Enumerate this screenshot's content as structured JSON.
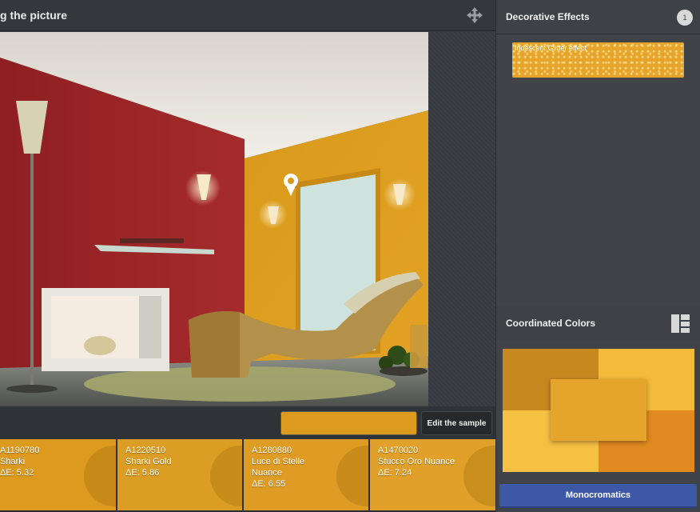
{
  "header": {
    "title": "g the picture",
    "move_icon": "move-arrows-icon"
  },
  "sample": {
    "color": "#dc9a1f",
    "edit_label": "Edit the sample"
  },
  "results": [
    {
      "code": "A1190780",
      "name_lines": [
        "Sharki"
      ],
      "delta": "ΔE: 5.32",
      "color": "#dc9a1f"
    },
    {
      "code": "A1220510",
      "name_lines": [
        "Sharki Gold"
      ],
      "delta": "ΔE: 5.86",
      "color": "#dc9d24"
    },
    {
      "code": "A1280880",
      "name_lines": [
        "Luce di Stelle",
        "Nuance"
      ],
      "delta": "ΔE: 6.55",
      "color": "#df9c25"
    },
    {
      "code": "A1470020",
      "name_lines": [
        "Stucco Oro Nuance"
      ],
      "delta": "ΔE: 7.24",
      "color": "#e0a029"
    }
  ],
  "decorative": {
    "title": "Decorative Effects",
    "count": "1",
    "effect_label": "Indescent Glitter effect"
  },
  "coordinated": {
    "title": "Coordinated Colors",
    "layout_icon": "layout-grid-icon",
    "colors": {
      "top_left": "#c7881f",
      "top_right": "#f4bb3a",
      "bottom_left": "#f6c043",
      "bottom_right": "#e08a20",
      "center": "#e5a42c"
    },
    "button_label": "Monocromatics"
  }
}
